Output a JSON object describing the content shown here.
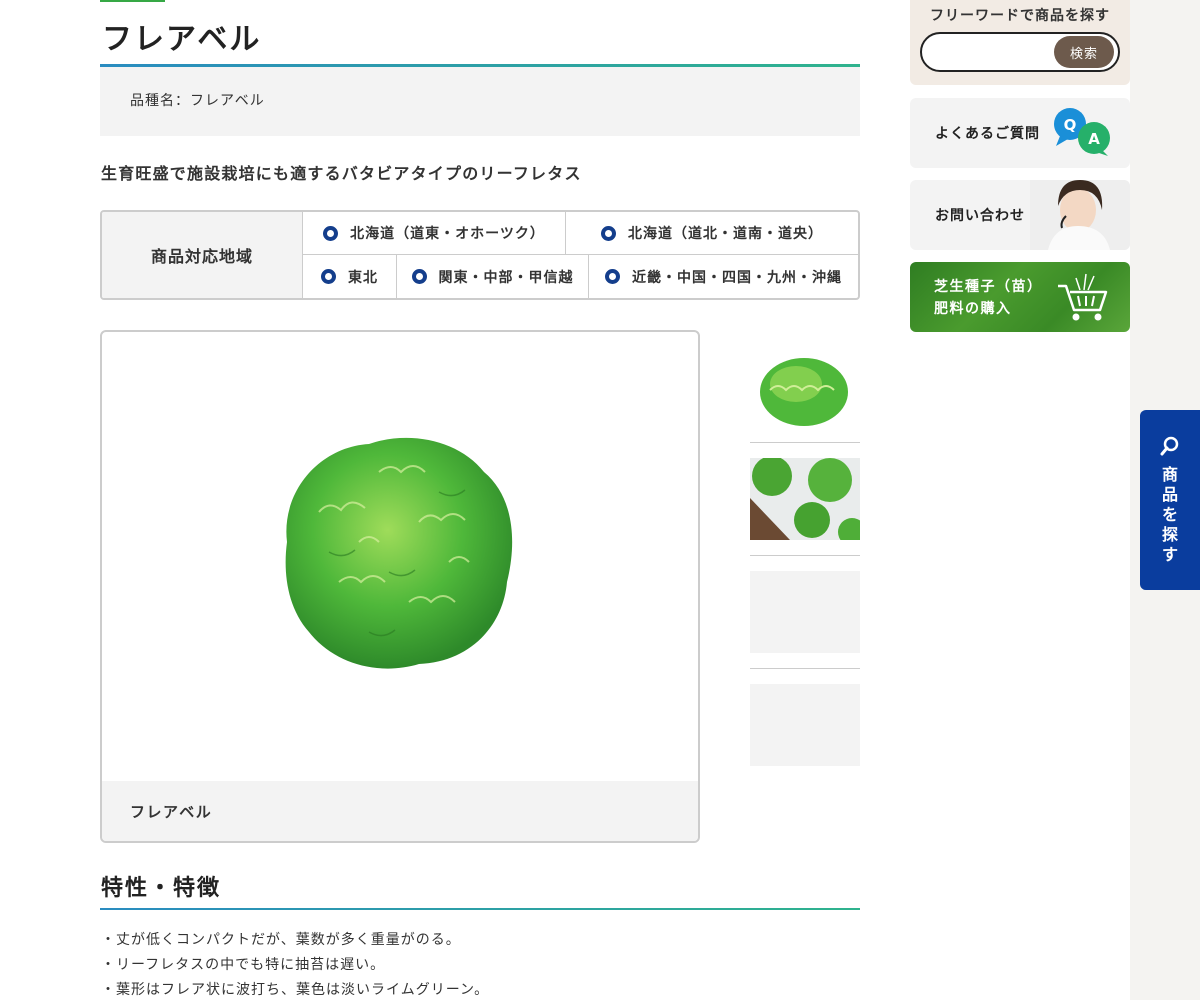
{
  "product": {
    "title": "フレアベル",
    "variety_line": "品種名：フレアベル",
    "catchcopy": "生育旺盛で施設栽培にも適するバタビアタイプのリーフレタス"
  },
  "regions": {
    "header": "商品対応地域",
    "row1": [
      "北海道（道東・オホーツク）",
      "北海道（道北・道南・道央）"
    ],
    "row2": [
      "東北",
      "関東・中部・甲信越",
      "近畿・中国・四国・九州・沖縄"
    ]
  },
  "gallery": {
    "caption": "フレアベル"
  },
  "features": {
    "heading": "特性・特徴",
    "items": [
      "・丈が低くコンパクトだが、葉数が多く重量がのる。",
      "・リーフレタスの中でも特に抽苔は遅い。",
      "・葉形はフレア状に波打ち、葉色は淡いライムグリーン。"
    ]
  },
  "sidebar": {
    "search_label": "フリーワードで商品を探す",
    "search_button": "検索",
    "faq_label": "よくあるご質問",
    "contact_label": "お問い合わせ",
    "shop_label_1": "芝生種子（苗）",
    "shop_label_2": "肥料の購入"
  },
  "floating_tab": {
    "label": "商品を探す"
  },
  "colors": {
    "accent_blue": "#143e8c",
    "tab_blue": "#0a3d9e",
    "rule_gradient": [
      "#2a8cc0",
      "#2fb38d"
    ],
    "faq_q": "#1a8fd8",
    "faq_a": "#26b06a"
  },
  "icons": [
    "search-icon",
    "qa-bubble-icon",
    "operator-photo",
    "cart-icon",
    "radio-icon"
  ]
}
